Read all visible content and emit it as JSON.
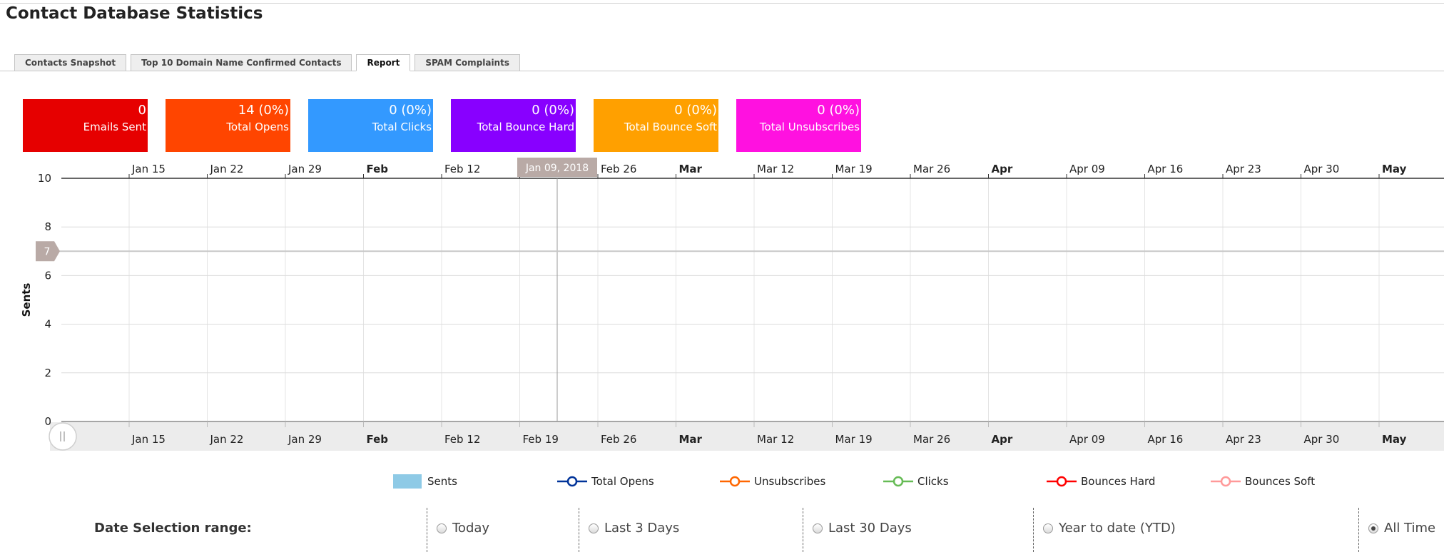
{
  "page": {
    "title": "Contact Database Statistics"
  },
  "tabs": [
    {
      "label": "Contacts Snapshot",
      "active": false
    },
    {
      "label": "Top 10 Domain Name Confirmed Contacts",
      "active": false
    },
    {
      "label": "Report",
      "active": true
    },
    {
      "label": "SPAM Complaints",
      "active": false
    }
  ],
  "stat_cards": [
    {
      "value": "0",
      "label": "Emails Sent",
      "color": "#e60000"
    },
    {
      "value": "14 (0%)",
      "label": "Total Opens",
      "color": "#ff4500"
    },
    {
      "value": "0 (0%)",
      "label": "Total Clicks",
      "color": "#3399ff"
    },
    {
      "value": "0 (0%)",
      "label": "Total Bounce Hard",
      "color": "#8800ff"
    },
    {
      "value": "0 (0%)",
      "label": "Total Bounce Soft",
      "color": "#ffa000"
    },
    {
      "value": "0 (0%)",
      "label": "Total Unsubscribes",
      "color": "#ff11e0"
    }
  ],
  "chart_data": {
    "type": "line",
    "ylabel": "Sents",
    "ylim": [
      0,
      10
    ],
    "yticks": [
      0,
      2,
      4,
      6,
      8,
      10
    ],
    "x_tick_labels": [
      {
        "label": "Jan 15",
        "bold": false
      },
      {
        "label": "Jan 22",
        "bold": false
      },
      {
        "label": "Jan 29",
        "bold": false
      },
      {
        "label": "Feb",
        "bold": true
      },
      {
        "label": "Feb 12",
        "bold": false
      },
      {
        "label": "Feb 19",
        "bold": false
      },
      {
        "label": "Feb 26",
        "bold": false
      },
      {
        "label": "Mar",
        "bold": true
      },
      {
        "label": "Mar 12",
        "bold": false
      },
      {
        "label": "Mar 19",
        "bold": false
      },
      {
        "label": "Mar 26",
        "bold": false
      },
      {
        "label": "Apr",
        "bold": true
      },
      {
        "label": "Apr 09",
        "bold": false
      },
      {
        "label": "Apr 16",
        "bold": false
      },
      {
        "label": "Apr 23",
        "bold": false
      },
      {
        "label": "Apr 30",
        "bold": false
      },
      {
        "label": "May",
        "bold": true
      }
    ],
    "top_axis_hidden_labels": [
      "Feb 19"
    ],
    "crosshair": {
      "x_label": "Jan 09, 2018",
      "y_value": 7
    },
    "grid": true,
    "series": [
      {
        "name": "Sents",
        "color": "#8ecae6",
        "values": []
      },
      {
        "name": "Total Opens",
        "color": "#003399",
        "values": []
      },
      {
        "name": "Unsubscribes",
        "color": "#ff6600",
        "values": []
      },
      {
        "name": "Clicks",
        "color": "#66bb55",
        "values": []
      },
      {
        "name": "Bounces Hard",
        "color": "#ff0000",
        "values": []
      },
      {
        "name": "Bounces Soft",
        "color": "#ff9999",
        "values": []
      }
    ],
    "legend_position": "bottom"
  },
  "date_selection": {
    "label": "Date Selection range:",
    "options": [
      {
        "label": "Today",
        "checked": false
      },
      {
        "label": "Last 3 Days",
        "checked": false
      },
      {
        "label": "Last 30 Days",
        "checked": false
      },
      {
        "label": "Year to date (YTD)",
        "checked": false
      },
      {
        "label": "All Time",
        "checked": true
      }
    ]
  }
}
